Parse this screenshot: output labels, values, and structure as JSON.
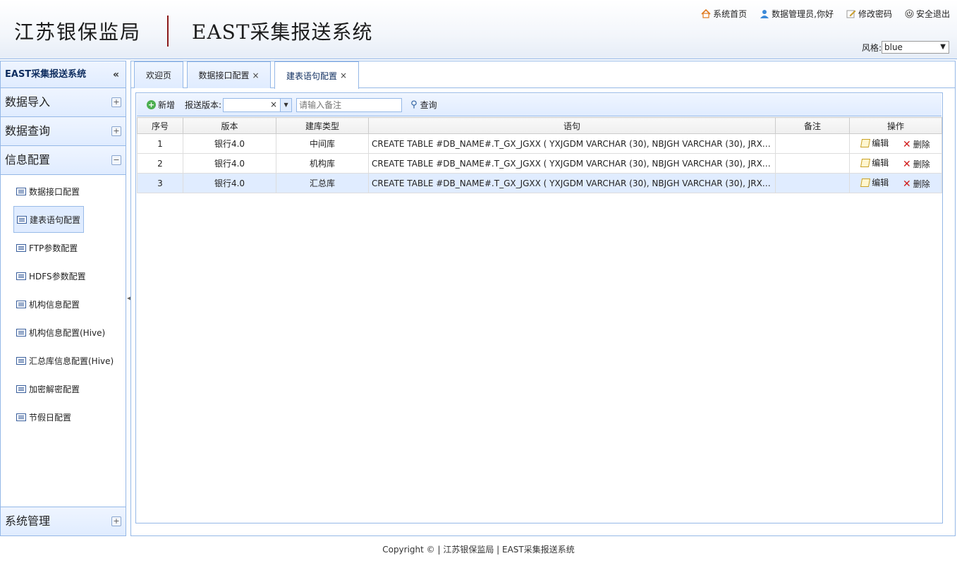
{
  "header": {
    "org_name": "江苏银保监局",
    "system_name": "EAST采集报送系统",
    "links": [
      "系统首页",
      "数据管理员,你好",
      "修改密码",
      "安全退出"
    ],
    "style_label": "风格:",
    "style_value": "blue"
  },
  "sidebar": {
    "title": "EAST采集报送系统",
    "collapse_glyph": "«",
    "groups": [
      {
        "label": "数据导入",
        "toggle": "+"
      },
      {
        "label": "数据查询",
        "toggle": "+"
      },
      {
        "label": "信息配置",
        "toggle": "−"
      }
    ],
    "items": [
      "数据接口配置",
      "建表语句配置",
      "FTP参数配置",
      "HDFS参数配置",
      "机构信息配置",
      "机构信息配置(Hive)",
      "汇总库信息配置(Hive)",
      "加密解密配置",
      "节假日配置"
    ],
    "bottom_group": {
      "label": "系统管理",
      "toggle": "+"
    }
  },
  "tabs": [
    {
      "label": "欢迎页"
    },
    {
      "label": "数据接口配置",
      "close": "×"
    },
    {
      "label": "建表语句配置",
      "close": "×"
    }
  ],
  "toolbar": {
    "add_label": "新增",
    "version_label": "报送版本:",
    "clear_glyph": "×",
    "remark_placeholder": "请输入备注",
    "search_label": "查询"
  },
  "table": {
    "columns": [
      "序号",
      "版本",
      "建库类型",
      "语句",
      "备注",
      "操作"
    ],
    "edit_label": "编辑",
    "delete_label": "删除",
    "rows": [
      {
        "no": "1",
        "version": "银行4.0",
        "type": "中间库",
        "sql": "CREATE TABLE #DB_NAME#.T_GX_JGXX ( YXJGDM VARCHAR (30), NBJGH VARCHAR (30), JRXKZH VAR..",
        "remark": ""
      },
      {
        "no": "2",
        "version": "银行4.0",
        "type": "机构库",
        "sql": "CREATE TABLE #DB_NAME#.T_GX_JGXX ( YXJGDM VARCHAR (30), NBJGH VARCHAR (30), JRXKZH VAR..",
        "remark": ""
      },
      {
        "no": "3",
        "version": "银行4.0",
        "type": "汇总库",
        "sql": "CREATE TABLE #DB_NAME#.T_GX_JGXX ( YXJGDM VARCHAR (30), NBJGH VARCHAR (30), JRXKZH VAR..",
        "remark": ""
      }
    ]
  },
  "footer": "Copyright © | 江苏银保监局 | EAST采集报送系统"
}
